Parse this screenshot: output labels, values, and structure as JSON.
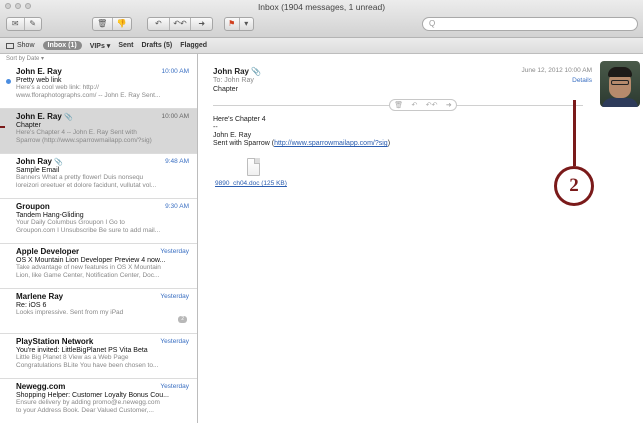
{
  "window": {
    "title": "Inbox (1904 messages, 1 unread)"
  },
  "toolbar": {
    "search_placeholder": "Q"
  },
  "favorites": {
    "show": "Show",
    "inbox": "Inbox (1)",
    "vips": "VIPs ▾",
    "sent": "Sent",
    "drafts": "Drafts (5)",
    "flagged": "Flagged"
  },
  "list": {
    "sort_label": "Sort by Date ▾",
    "messages": [
      {
        "from": "John E. Ray",
        "time": "10:00 AM",
        "subject": "Pretty web link",
        "preview1": "Here's a cool web link: http://",
        "preview2": "www.fforaphotographs.com/ -- John E. Ray Sent...",
        "unread": true
      },
      {
        "from": "John E. Ray",
        "time": "10:00 AM",
        "subject": "Chapter",
        "preview1": "Here's Chapter 4 -- John E. Ray Sent with",
        "preview2": "Sparrow (http://www.sparrowmailapp.com/?sig)",
        "selected": true,
        "attachment": true
      },
      {
        "from": "John Ray",
        "time": "9:48 AM",
        "subject": "Sample Email",
        "preview1": "Banners What a pretty flower! Duis nonsequ",
        "preview2": "loreizori oreetuer et dolore facidunt, vullutat vol...",
        "attachment": true
      },
      {
        "from": "Groupon",
        "time": "9:30 AM",
        "subject": "Tandem Hang-Gliding",
        "preview1": "Your Daily Columbus Groupon I Go to",
        "preview2": "Groupon.com I Unsubscribe Be sure to add mail..."
      },
      {
        "from": "Apple Developer",
        "time": "Yesterday",
        "subject": "OS X Mountain Lion Developer Preview 4 now...",
        "preview1": "Take advantage of new features in OS X Mountain",
        "preview2": "Lion, like Game Center, Notification Center, Doc..."
      },
      {
        "from": "Marlene Ray",
        "time": "Yesterday",
        "subject": "Re: iOS 6",
        "preview1": "Looks impressive. Sent from my iPad",
        "preview2": "",
        "badge": "2"
      },
      {
        "from": "PlayStation Network",
        "time": "Yesterday",
        "subject": "You're invited: LittleBigPlanet PS Vita Beta",
        "preview1": "Little Big Planet 8 View as a Web Page",
        "preview2": "Congratulations BLite You have been chosen to..."
      },
      {
        "from": "Newegg.com",
        "time": "Yesterday",
        "subject": "Shopping Helper: Customer Loyalty Bonus Cou...",
        "preview1": "Ensure delivery by adding promo@e.newegg.com",
        "preview2": "to your Address Book. Dear Valued Customer,..."
      }
    ]
  },
  "reader": {
    "from": "John Ray",
    "to": "To: John Ray",
    "subject": "Chapter",
    "date": "June 12, 2012  10:00 AM",
    "details": "Details",
    "body_line1": "Here's Chapter 4",
    "body_line2": "--",
    "body_line3": "John E. Ray",
    "body_line4_prefix": "Sent with Sparrow (",
    "body_link": "http://www.sparrowmailapp.com/?sig",
    "body_line4_suffix": ")",
    "attachment_name": "9890_ch04.doc (125 KB)"
  },
  "annotation": {
    "callout_number": "2",
    "color": "#7a1a1a"
  }
}
